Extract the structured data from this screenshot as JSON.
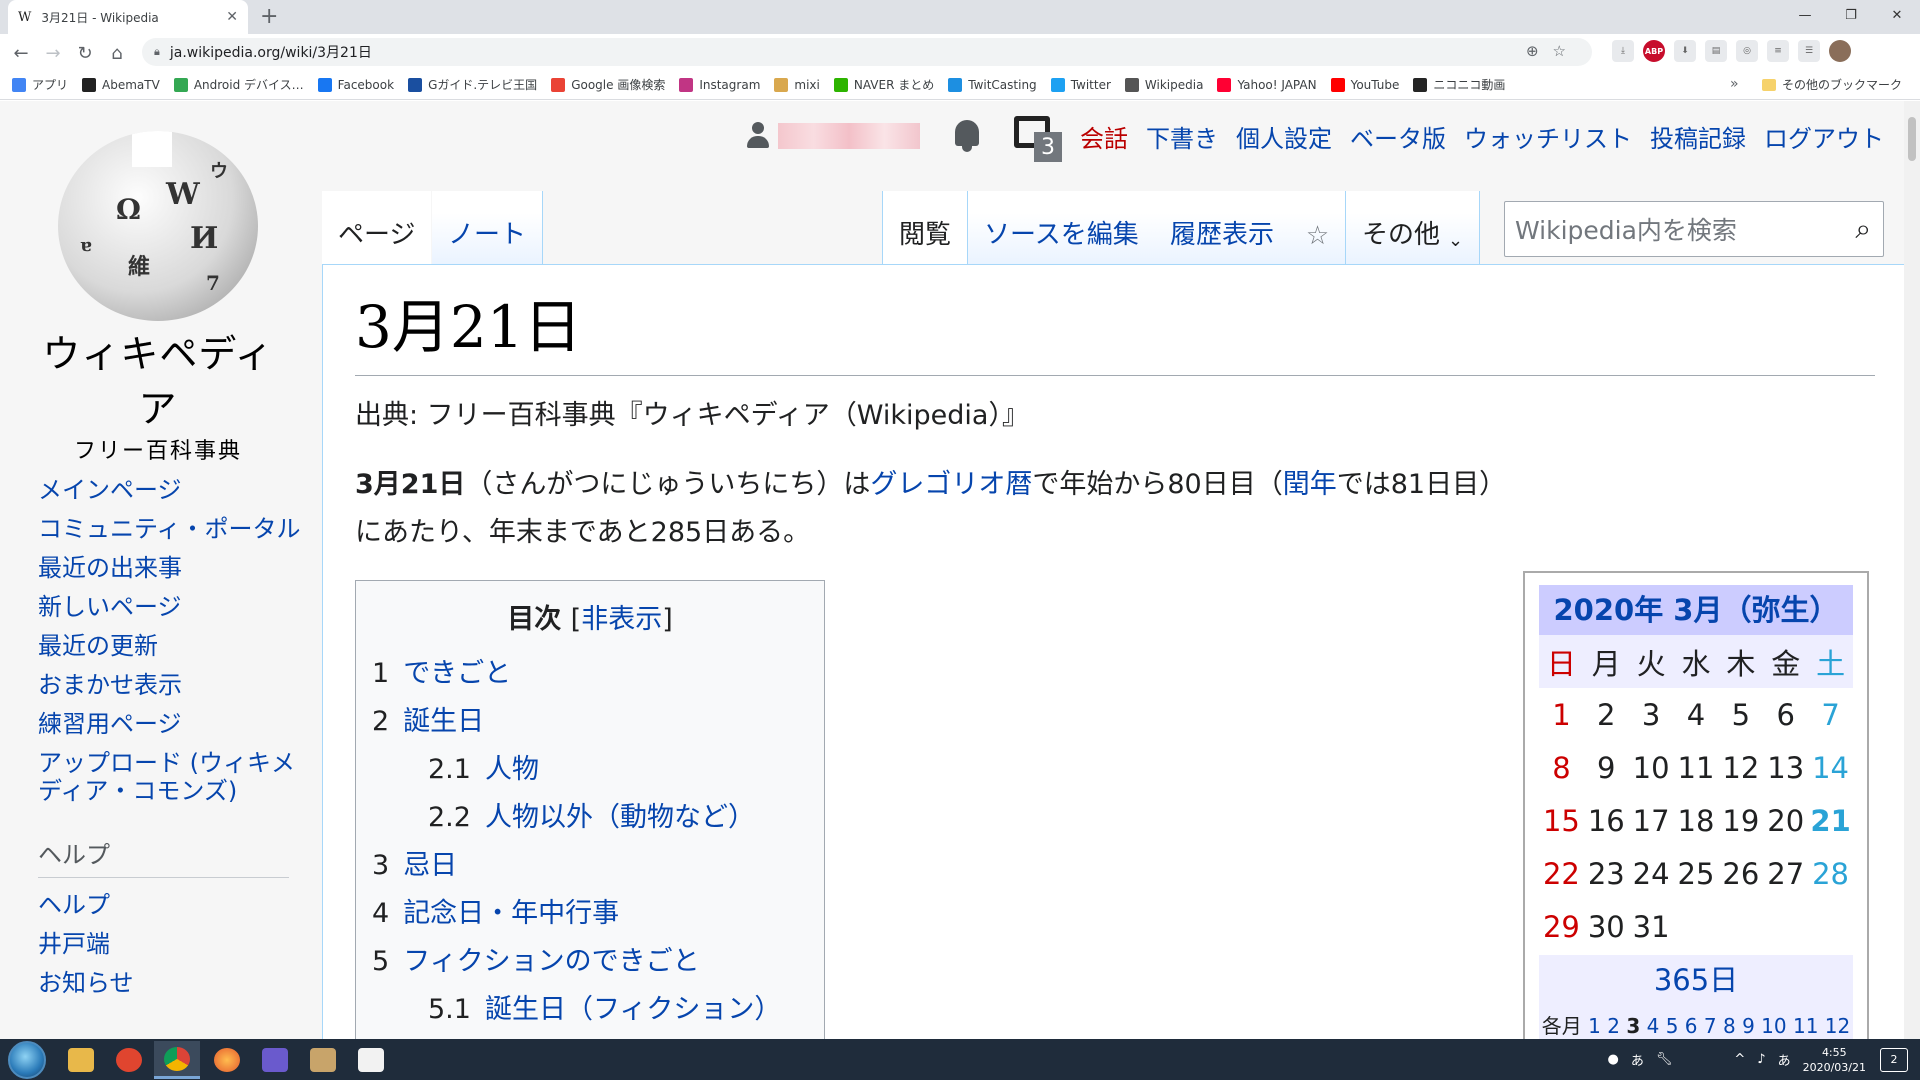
{
  "browser": {
    "tab_title": "3月21日 - Wikipedia",
    "tab_favicon": "W",
    "new_tab": "+",
    "url": "ja.wikipedia.org/wiki/3月21日",
    "bookmarks": [
      {
        "label": "アプリ",
        "icon_color": "#4285f4",
        "icon": "grid-icon"
      },
      {
        "label": "AbemaTV",
        "icon_color": "#222222",
        "icon": "abema-icon"
      },
      {
        "label": "Android デバイス…",
        "icon_color": "#34a853",
        "icon": "android-icon"
      },
      {
        "label": "Facebook",
        "icon_color": "#1877f2",
        "icon": "facebook-icon"
      },
      {
        "label": "Gガイド.テレビ王国",
        "icon_color": "#1a4fa0",
        "icon": "gguide-icon"
      },
      {
        "label": "Google 画像検索",
        "icon_color": "#ea4335",
        "icon": "google-icon"
      },
      {
        "label": "Instagram",
        "icon_color": "#c13584",
        "icon": "instagram-icon"
      },
      {
        "label": "mixi",
        "icon_color": "#d9a84e",
        "icon": "mixi-icon"
      },
      {
        "label": "NAVER まとめ",
        "icon_color": "#2db400",
        "icon": "naver-icon"
      },
      {
        "label": "TwitCasting",
        "icon_color": "#1d8fe1",
        "icon": "twitcasting-icon"
      },
      {
        "label": "Twitter",
        "icon_color": "#1da1f2",
        "icon": "twitter-icon"
      },
      {
        "label": "Wikipedia",
        "icon_color": "#555555",
        "icon": "wikipedia-icon"
      },
      {
        "label": "Yahoo! JAPAN",
        "icon_color": "#ff0033",
        "icon": "yahoo-icon"
      },
      {
        "label": "YouTube",
        "icon_color": "#ff0000",
        "icon": "youtube-icon"
      },
      {
        "label": "ニコニコ動画",
        "icon_color": "#252525",
        "icon": "niconico-icon"
      }
    ],
    "bookmarks_more": "»",
    "other_bookmarks": "その他のブックマーク"
  },
  "wiki": {
    "logo_name": "ウィキペディア",
    "logo_tagline": "フリー百科事典",
    "personal": {
      "notice_count": "3",
      "talk": "会話",
      "drafts": "下書き",
      "preferences": "個人設定",
      "beta": "ベータ版",
      "watchlist": "ウォッチリスト",
      "contributions": "投稿記録",
      "logout": "ログアウト"
    },
    "tabs": {
      "page": "ページ",
      "note": "ノート",
      "read": "閲覧",
      "edit": "ソースを編集",
      "history": "履歴表示",
      "more": "その他"
    },
    "search_placeholder": "Wikipedia内を検索",
    "sidebar": [
      "メインページ",
      "コミュニティ・ポータル",
      "最近の出来事",
      "新しいページ",
      "最近の更新",
      "おまかせ表示",
      "練習用ページ",
      "アップロード (ウィキメディア・コモンズ)"
    ],
    "help_heading": "ヘルプ",
    "help_items": [
      "ヘルプ",
      "井戸端",
      "お知らせ"
    ],
    "heading": "3月21日",
    "site_sub": "出典: フリー百科事典『ウィキペディア（Wikipedia）』",
    "lead": {
      "bold": "3月21日",
      "t1": "（さんがつにじゅういちにち）は",
      "link1": "グレゴリオ暦",
      "t2": "で年始から80日目（",
      "link2": "閏年",
      "t3": "では81日目）にあたり、年末まであと285日ある。"
    },
    "toc": {
      "title": "目次",
      "hide_open": "[",
      "hide": "非表示",
      "hide_close": "]",
      "items": [
        {
          "num": "1",
          "text": "できごと",
          "level": 1
        },
        {
          "num": "2",
          "text": "誕生日",
          "level": 1
        },
        {
          "num": "2.1",
          "text": "人物",
          "level": 2
        },
        {
          "num": "2.2",
          "text": "人物以外（動物など）",
          "level": 2
        },
        {
          "num": "3",
          "text": "忌日",
          "level": 1
        },
        {
          "num": "4",
          "text": "記念日・年中行事",
          "level": 1
        },
        {
          "num": "5",
          "text": "フィクションのできごと",
          "level": 1
        },
        {
          "num": "5.1",
          "text": "誕生日（フィクション）",
          "level": 2
        }
      ]
    },
    "calendar": {
      "title": "2020年 3月（弥生）",
      "weekdays": [
        "日",
        "月",
        "火",
        "水",
        "木",
        "金",
        "土"
      ],
      "weeks": [
        [
          "1",
          "2",
          "3",
          "4",
          "5",
          "6",
          "7"
        ],
        [
          "8",
          "9",
          "10",
          "11",
          "12",
          "13",
          "14"
        ],
        [
          "15",
          "16",
          "17",
          "18",
          "19",
          "20",
          "21"
        ],
        [
          "22",
          "23",
          "24",
          "25",
          "26",
          "27",
          "28"
        ],
        [
          "29",
          "30",
          "31",
          "",
          "",
          "",
          ""
        ]
      ],
      "today": "21",
      "days365": "365日",
      "months_label": "各月",
      "months": [
        "1",
        "2",
        "3",
        "4",
        "5",
        "6",
        "7",
        "8",
        "9",
        "10",
        "11",
        "12"
      ],
      "current_month": "3"
    }
  },
  "taskbar": {
    "ime": "あ",
    "ime2": "あ",
    "time": "4:55",
    "date": "2020/03/21",
    "notification_count": "2"
  },
  "colors": {
    "link": "#0645ad",
    "redlink": "#ba0000",
    "sunday": "#cc0000",
    "saturday": "#2aa3d6"
  }
}
